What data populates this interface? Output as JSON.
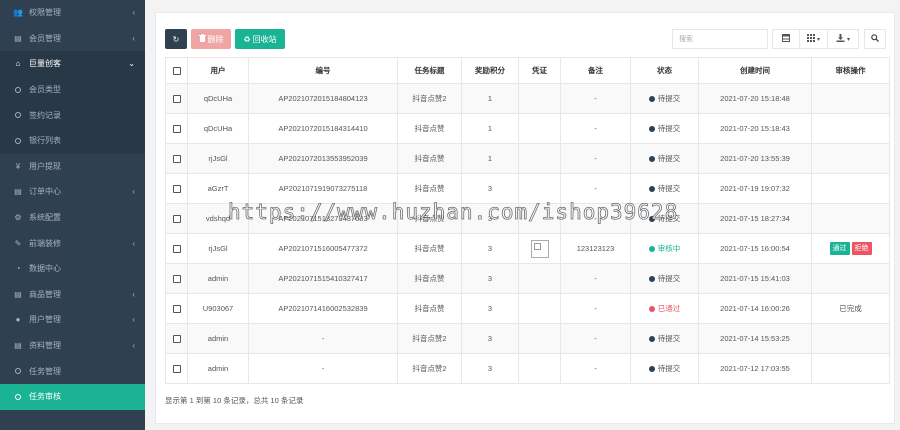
{
  "sidebar": {
    "items": [
      {
        "label": "权限管理",
        "icon": "users-icon",
        "chevron": "‹",
        "state": "normal"
      },
      {
        "label": "会员管理",
        "icon": "list-icon",
        "chevron": "‹",
        "state": "normal"
      },
      {
        "label": "巨量创客",
        "icon": "home-icon",
        "chevron": "⌄",
        "state": "open"
      },
      {
        "label": "会员类型",
        "icon": "circle-icon",
        "chevron": "",
        "state": "sub"
      },
      {
        "label": "签约记录",
        "icon": "circle-icon",
        "chevron": "",
        "state": "sub"
      },
      {
        "label": "银行列表",
        "icon": "circle-icon",
        "chevron": "",
        "state": "sub"
      },
      {
        "label": "用户提现",
        "icon": "yen-icon",
        "chevron": "",
        "state": "normal"
      },
      {
        "label": "订单中心",
        "icon": "file-icon",
        "chevron": "‹",
        "state": "normal"
      },
      {
        "label": "系统配置",
        "icon": "gear-icon",
        "chevron": "",
        "state": "normal"
      },
      {
        "label": "前端装修",
        "icon": "brush-icon",
        "chevron": "‹",
        "state": "normal"
      },
      {
        "label": "数据中心",
        "icon": "dashboard-icon",
        "chevron": "",
        "state": "normal"
      },
      {
        "label": "商品管理",
        "icon": "list-icon",
        "chevron": "‹",
        "state": "normal"
      },
      {
        "label": "用户管理",
        "icon": "user-icon",
        "chevron": "‹",
        "state": "normal"
      },
      {
        "label": "资料管理",
        "icon": "document-icon",
        "chevron": "‹",
        "state": "normal"
      },
      {
        "label": "任务管理",
        "icon": "circle-icon",
        "chevron": "",
        "state": "normal"
      },
      {
        "label": "任务审核",
        "icon": "circle-icon",
        "chevron": "",
        "state": "active"
      }
    ]
  },
  "toolbar": {
    "refresh_icon": "↻",
    "delete_label": "删除",
    "recycle_label": "回收站",
    "search_placeholder": "搜索"
  },
  "table": {
    "headers": [
      "",
      "用户",
      "编号",
      "任务标题",
      "奖励积分",
      "凭证",
      "备注",
      "状态",
      "创建时间",
      "审核操作"
    ],
    "rows": [
      {
        "user": "qDcUHa",
        "code": "AP2021072015184804123",
        "title": "抖音点赞2",
        "points": "1",
        "proof": "",
        "note": "-",
        "status": "待提交",
        "time": "2021-07-20 15:18:48",
        "op": ""
      },
      {
        "user": "qDcUHa",
        "code": "AP2021072015184314410",
        "title": "抖音点赞",
        "points": "1",
        "proof": "",
        "note": "-",
        "status": "待提交",
        "time": "2021-07-20 15:18:43",
        "op": ""
      },
      {
        "user": "rjJsGl",
        "code": "AP2021072013553952039",
        "title": "抖音点赞",
        "points": "1",
        "proof": "",
        "note": "-",
        "status": "待提交",
        "time": "2021-07-20 13:55:39",
        "op": ""
      },
      {
        "user": "aGzrT",
        "code": "AP2021071919073275118",
        "title": "抖音点赞",
        "points": "3",
        "proof": "",
        "note": "-",
        "status": "待提交",
        "time": "2021-07-19 19:07:32",
        "op": ""
      },
      {
        "user": "vdshqd",
        "code": "AP2021071518273437683",
        "title": "抖音点赞",
        "points": "3",
        "proof": "",
        "note": "-",
        "status": "待提交",
        "time": "2021-07-15 18:27:34",
        "op": ""
      },
      {
        "user": "rjJsGl",
        "code": "AP2021071516005477372",
        "title": "抖音点赞",
        "points": "3",
        "proof": "image",
        "note": "123123123",
        "status": "审核中",
        "time": "2021-07-15 16:00:54",
        "op": "buttons"
      },
      {
        "user": "admin",
        "code": "AP2021071515410327417",
        "title": "抖音点赞",
        "points": "3",
        "proof": "",
        "note": "-",
        "status": "待提交",
        "time": "2021-07-15 15:41:03",
        "op": ""
      },
      {
        "user": "U903067",
        "code": "AP2021071416002532839",
        "title": "抖音点赞",
        "points": "3",
        "proof": "",
        "note": "-",
        "status": "已通过",
        "time": "2021-07-14 16:00:26",
        "op": "已完成"
      },
      {
        "user": "admin",
        "code": "-",
        "title": "抖音点赞2",
        "points": "3",
        "proof": "",
        "note": "-",
        "status": "待提交",
        "time": "2021-07-14 15:53:25",
        "op": ""
      },
      {
        "user": "admin",
        "code": "-",
        "title": "抖音点赞2",
        "points": "3",
        "proof": "",
        "note": "-",
        "status": "待提交",
        "time": "2021-07-12 17:03:55",
        "op": ""
      }
    ],
    "approve_label": "通过",
    "reject_label": "拒绝"
  },
  "status_colors": {
    "待提交": "#2f4050",
    "审核中": "#1ab394",
    "已通过": "#ed5565"
  },
  "colors": {
    "accent": "#1ab394",
    "sidebar": "#2f4050",
    "approve": "#1ab394",
    "reject": "#ed5565"
  },
  "footer": {
    "info": "显示第 1 到第 10 条记录，总共 10 条记录"
  },
  "watermark": "https://www.huzhan.com/ishop39628"
}
